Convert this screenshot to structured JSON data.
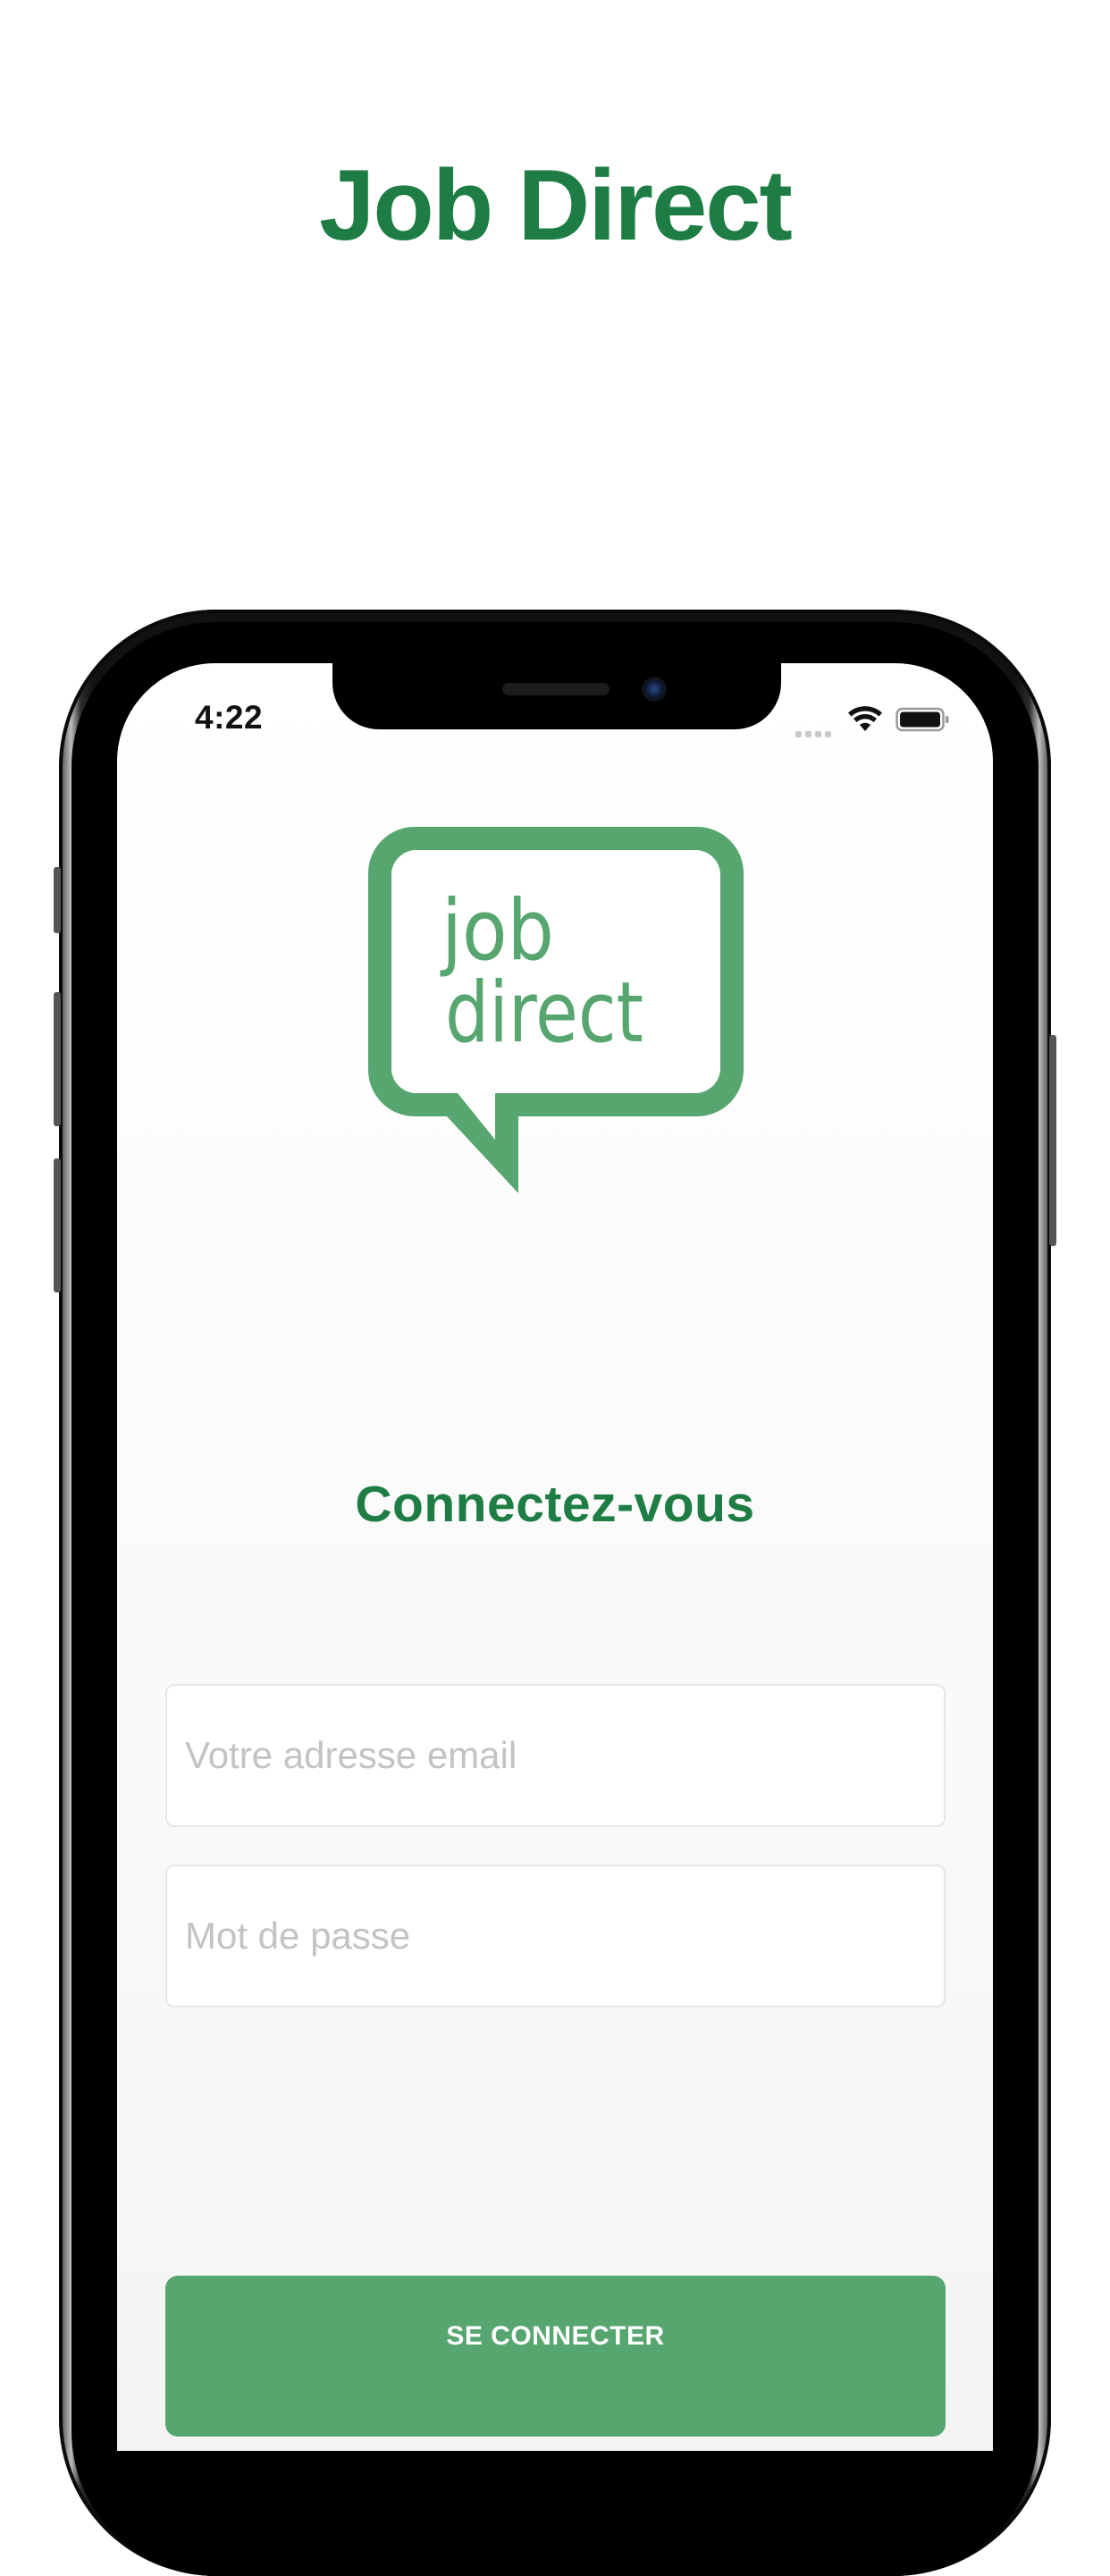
{
  "promo": {
    "title": "Job Direct"
  },
  "status_bar": {
    "time": "4:22"
  },
  "logo": {
    "line1": "job",
    "line2": "direct"
  },
  "login": {
    "heading": "Connectez-vous",
    "email_placeholder": "Votre adresse email",
    "email_value": "",
    "password_placeholder": "Mot de passe",
    "password_value": "",
    "submit_label": "SE CONNECTER"
  },
  "icons": {
    "wifi": "wifi-icon",
    "battery": "battery-icon",
    "signal": "cellular-signal-icon"
  },
  "colors": {
    "brand_dark": "#1e7d45",
    "brand_light": "#57a670",
    "placeholder": "#c3c3c3"
  }
}
